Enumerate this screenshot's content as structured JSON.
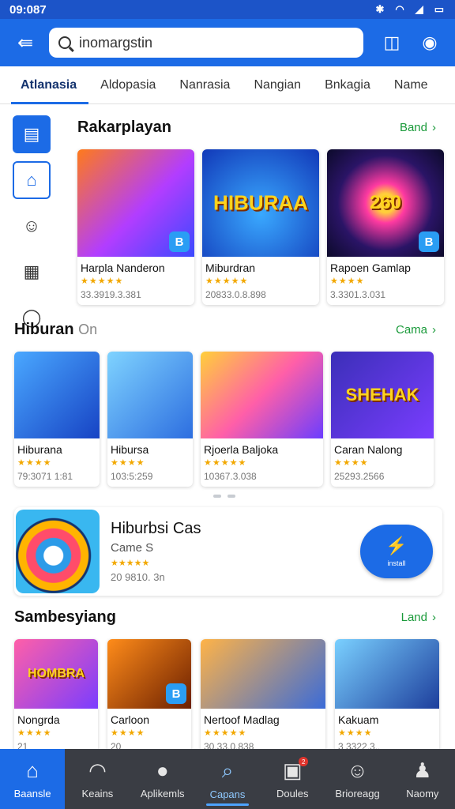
{
  "status": {
    "time": "09:087",
    "icons": [
      "bluetooth-icon",
      "wifi-icon",
      "signal-icon",
      "battery-icon"
    ]
  },
  "search": {
    "value": "inomargstin"
  },
  "tabs": [
    "Atlanasia",
    "Aldopasia",
    "Nanrasia",
    "Nangian",
    "Bnkagia",
    "Name"
  ],
  "sections": [
    {
      "title": "Rakarplayan",
      "more": "Band",
      "cards": [
        {
          "name": "Harpla Nanderon",
          "num": "33.3919.3.381",
          "stars": "★★★★★",
          "badge": "B",
          "art": ""
        },
        {
          "name": "Miburdran",
          "num": "20833.0.8.898",
          "stars": "★★★★★",
          "badge": "",
          "art": "HIBURAA"
        },
        {
          "name": "Rapoen Gamlap",
          "num": "3.3301.3.031",
          "stars": "★★★★",
          "badge": "B",
          "art": "260"
        }
      ]
    },
    {
      "title": "Hiburan",
      "title_suffix": "On",
      "more": "Cama",
      "cards": [
        {
          "name": "Hiburana",
          "num": "79:3071 1:81",
          "stars": "★★★★",
          "badge": "",
          "art": ""
        },
        {
          "name": "Hibursa",
          "num": "103:5:259",
          "stars": "★★★★",
          "badge": "",
          "art": ""
        },
        {
          "name": "Rjoerla Baljoka",
          "num": "10367.3.038",
          "stars": "★★★★★",
          "badge": "",
          "art": ""
        },
        {
          "name": "Caran Nalong",
          "num": "25293.2566",
          "stars": "★★★★",
          "badge": "",
          "art": "SHEHAK"
        }
      ]
    },
    {
      "title": "Sambesyiang",
      "more": "Land",
      "cards": [
        {
          "name": "Nongrda",
          "num": "21",
          "stars": "★★★★",
          "badge": "",
          "art": "HOMBRA"
        },
        {
          "name": "Carloon",
          "num": "20",
          "stars": "★★★★",
          "badge": "B",
          "art": ""
        },
        {
          "name": "Nertoof Madlag",
          "num": "30.33.0.838",
          "stars": "★★★★★",
          "badge": "",
          "art": ""
        },
        {
          "name": "Kakuam",
          "num": "3 3322.3..",
          "stars": "★★★★",
          "badge": "",
          "art": ""
        }
      ]
    }
  ],
  "feature": {
    "title": "Hiburbsi Cas",
    "subtitle": "Came S",
    "stars": "★★★★★",
    "num": "20 9810. 3n",
    "button_label": "install"
  },
  "bottom_nav": [
    {
      "label": "Baansle",
      "icon": "home-icon"
    },
    {
      "label": "Keains",
      "icon": "wifi-icon"
    },
    {
      "label": "Aplikemls",
      "icon": "apps-icon"
    },
    {
      "label": "Capans",
      "icon": "search-icon"
    },
    {
      "label": "Doules",
      "icon": "games-icon",
      "badge": "2"
    },
    {
      "label": "Brioreagg",
      "icon": "chat-icon"
    },
    {
      "label": "Naomy",
      "icon": "profile-icon"
    }
  ]
}
